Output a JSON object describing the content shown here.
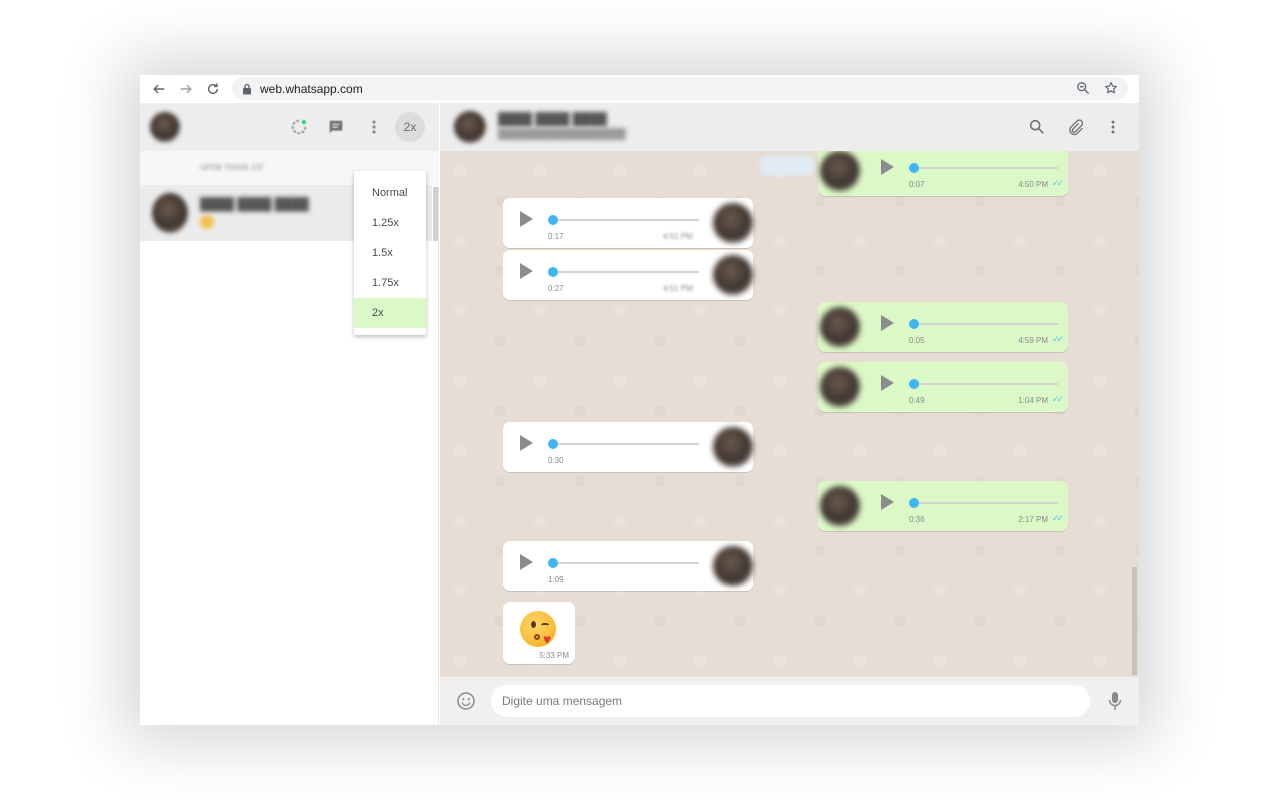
{
  "browser": {
    "url": "web.whatsapp.com"
  },
  "sidebar": {
    "speed_button_label": "2x",
    "notice_text_visible": "nova co",
    "notice_text_blurred": "uma",
    "speed_menu": {
      "options": [
        "Normal",
        "1.25x",
        "1.5x",
        "1.75x",
        "2x"
      ],
      "selected": "2x"
    }
  },
  "messages": [
    {
      "direction": "out",
      "duration": "0:07",
      "time": "4:50 PM",
      "status": "read"
    },
    {
      "direction": "in",
      "duration": "0:17",
      "time": "4:51 PM"
    },
    {
      "direction": "in",
      "duration": "0:27",
      "time": "4:51 PM"
    },
    {
      "direction": "out",
      "duration": "0:05",
      "time": "4:59 PM",
      "status": "read"
    },
    {
      "direction": "out",
      "duration": "0:49",
      "time": "1:04 PM",
      "status": "read"
    },
    {
      "direction": "in",
      "duration": "0:30",
      "time": ""
    },
    {
      "direction": "out",
      "duration": "0:36",
      "time": "2:17 PM",
      "status": "read"
    },
    {
      "direction": "in",
      "duration": "1:09",
      "time": ""
    }
  ],
  "emoji_message": {
    "emoji": "face-blowing-a-kiss",
    "time": "5:33 PM"
  },
  "composer": {
    "placeholder": "Digite uma mensagem"
  },
  "colors": {
    "outgoing_bubble": "#dcf8c6",
    "incoming_bubble": "#ffffff",
    "chat_wallpaper": "#e6ddd4",
    "voice_knob": "#3fb5f2",
    "read_ticks": "#4fc3f7",
    "header_bg": "#ededed"
  }
}
